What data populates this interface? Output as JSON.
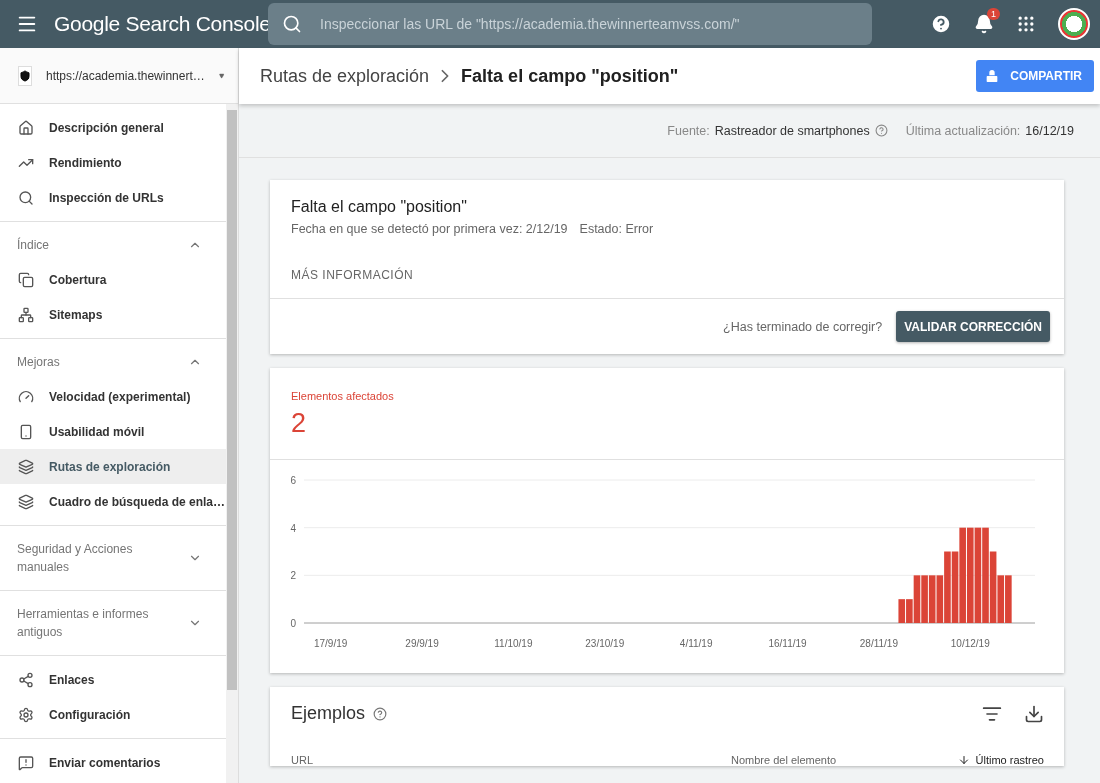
{
  "app": {
    "title": "Google Search Console",
    "search_placeholder": "Inspeccionar las URL de \"https://academia.thewinnerteamvss.com/\"",
    "notification_count": "1"
  },
  "property": "https://academia.thewinnert…",
  "sidebar": {
    "groups": [
      {
        "items": [
          {
            "label": "Descripción general",
            "selected": false
          },
          {
            "label": "Rendimiento",
            "selected": false
          },
          {
            "label": "Inspección de URLs",
            "selected": false
          }
        ]
      },
      {
        "title": "Índice",
        "expanded": true,
        "items": [
          {
            "label": "Cobertura",
            "selected": false
          },
          {
            "label": "Sitemaps",
            "selected": false
          }
        ]
      },
      {
        "title": "Mejoras",
        "expanded": true,
        "items": [
          {
            "label": "Velocidad (experimental)",
            "selected": false
          },
          {
            "label": "Usabilidad móvil",
            "selected": false
          },
          {
            "label": "Rutas de exploración",
            "selected": true
          },
          {
            "label": "Cuadro de búsqueda de enla…",
            "selected": false
          }
        ]
      },
      {
        "title": "Seguridad y Acciones manuales",
        "expanded": false
      },
      {
        "title": "Herramientas e informes antiguos",
        "expanded": false
      },
      {
        "items": [
          {
            "label": "Enlaces",
            "selected": false
          },
          {
            "label": "Configuración",
            "selected": false
          }
        ]
      },
      {
        "items": [
          {
            "label": "Enviar comentarios",
            "selected": false
          }
        ]
      }
    ]
  },
  "breadcrumb": [
    "Rutas de exploración",
    "Falta el campo \"position\""
  ],
  "share_button": "COMPARTIR",
  "meta": {
    "source_label": "Fuente:",
    "source": "Rastreador de smartphones",
    "updated_label": "Última actualización:",
    "updated": "16/12/19"
  },
  "issue": {
    "title": "Falta el campo \"position\"",
    "detected": "Fecha en que se detectó por primera vez: 2/12/19",
    "status": "Estado: Error",
    "more_info": "MÁS INFORMACIÓN",
    "question": "¿Has terminado de corregir?",
    "validate_button": "VALIDAR CORRECCIÓN"
  },
  "affected": {
    "label": "Elementos afectados",
    "count": "2",
    "chart_data": {
      "type": "bar",
      "categories": [
        "17/9/19",
        null,
        null,
        null,
        null,
        null,
        null,
        null,
        null,
        null,
        null,
        null,
        "29/9/19",
        null,
        null,
        null,
        null,
        null,
        null,
        null,
        null,
        null,
        null,
        null,
        "11/10/19",
        null,
        null,
        null,
        null,
        null,
        null,
        null,
        null,
        null,
        null,
        null,
        "23/10/19",
        null,
        null,
        null,
        null,
        null,
        null,
        null,
        null,
        null,
        null,
        null,
        "4/11/19",
        null,
        null,
        null,
        null,
        null,
        null,
        null,
        null,
        null,
        null,
        null,
        "16/11/19",
        null,
        null,
        null,
        null,
        null,
        null,
        null,
        null,
        null,
        null,
        null,
        "28/11/19",
        null,
        null,
        null,
        null,
        null,
        null,
        null,
        null,
        null,
        null,
        null,
        "10/12/19",
        null,
        null,
        null,
        null,
        null
      ],
      "series": [
        {
          "color": "#db4437",
          "values": [
            0,
            0,
            0,
            0,
            0,
            0,
            0,
            0,
            0,
            0,
            0,
            0,
            0,
            0,
            0,
            0,
            0,
            0,
            0,
            0,
            0,
            0,
            0,
            0,
            0,
            0,
            0,
            0,
            0,
            0,
            0,
            0,
            0,
            0,
            0,
            0,
            0,
            0,
            0,
            0,
            0,
            0,
            0,
            0,
            0,
            0,
            0,
            0,
            0,
            0,
            0,
            0,
            0,
            0,
            0,
            0,
            0,
            0,
            0,
            0,
            0,
            0,
            0,
            0,
            0,
            0,
            0,
            0,
            0,
            0,
            0,
            0,
            0,
            0,
            0,
            1,
            1,
            2,
            2,
            2,
            2,
            3,
            3,
            4,
            4,
            4,
            4,
            3,
            2,
            2
          ]
        }
      ],
      "ylim": [
        0,
        6
      ],
      "yticks": [
        0,
        2,
        4,
        6
      ]
    }
  },
  "examples": {
    "title": "Ejemplos",
    "columns": [
      {
        "label": "URL",
        "sorted": false
      },
      {
        "label": "Nombre del elemento",
        "sorted": false
      },
      {
        "label": "Último rastreo",
        "sorted": true
      }
    ]
  }
}
